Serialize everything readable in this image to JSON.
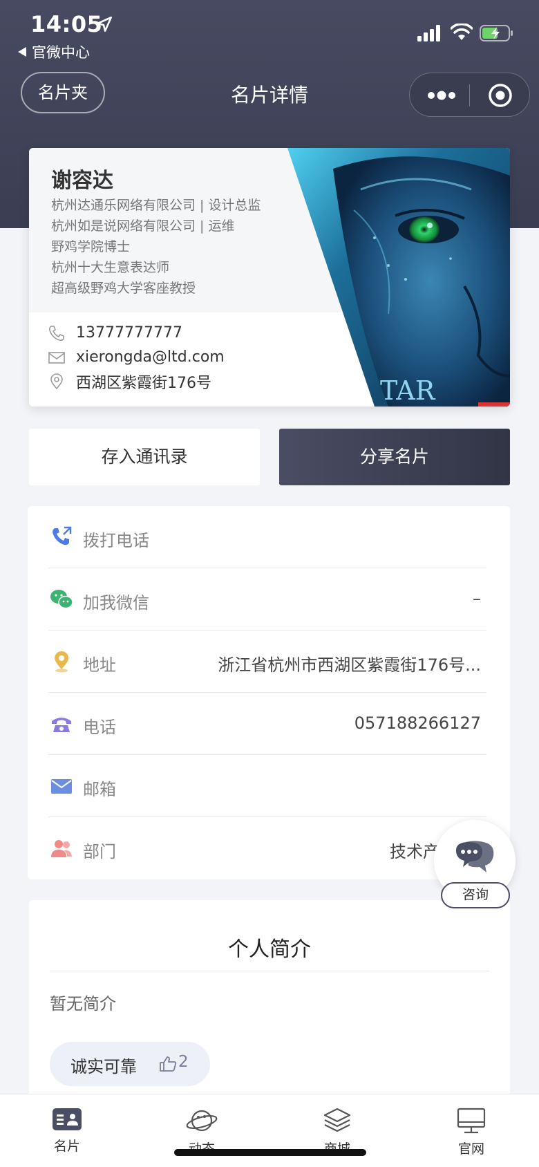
{
  "status_bar": {
    "time": "14:05",
    "back_label": "官微中心"
  },
  "nav": {
    "left_button": "名片夹",
    "title": "名片详情"
  },
  "card": {
    "name": "谢容达",
    "lines": [
      "杭州达通乐网络有限公司 | 设计总监",
      "杭州如是说网络有限公司 | 运维",
      "野鸡学院博士",
      "杭州十大生意表达师",
      "超高级野鸡大学客座教授"
    ],
    "phone": "13777777777",
    "email": "xierongda@ltd.com",
    "address": "西湖区紫霞街176号",
    "photo_text": "TAR"
  },
  "actions": {
    "save": "存入通讯录",
    "share": "分享名片"
  },
  "info": {
    "call_label": "拨打电话",
    "wechat_label": "加我微信",
    "wechat_value": "–",
    "address_label": "地址",
    "address_value": "浙江省杭州市西湖区紫霞街176号...",
    "tel_label": "电话",
    "tel_value": "057188266127",
    "email_label": "邮箱",
    "email_value": "",
    "dept_label": "部门",
    "dept_value": "技术产"
  },
  "consult": {
    "label": "咨询"
  },
  "intro": {
    "title": "个人简介",
    "empty": "暂无简介",
    "tag_label": "诚实可靠",
    "tag_count": "2"
  },
  "tabbar": {
    "items": [
      {
        "label": "名片",
        "icon": "card-icon"
      },
      {
        "label": "动态",
        "icon": "planet-icon"
      },
      {
        "label": "商城",
        "icon": "layers-icon"
      },
      {
        "label": "官网",
        "icon": "monitor-icon"
      }
    ]
  },
  "colors": {
    "header": "#474a60",
    "accent_dark": "#323546",
    "background": "#f3f4f8"
  }
}
